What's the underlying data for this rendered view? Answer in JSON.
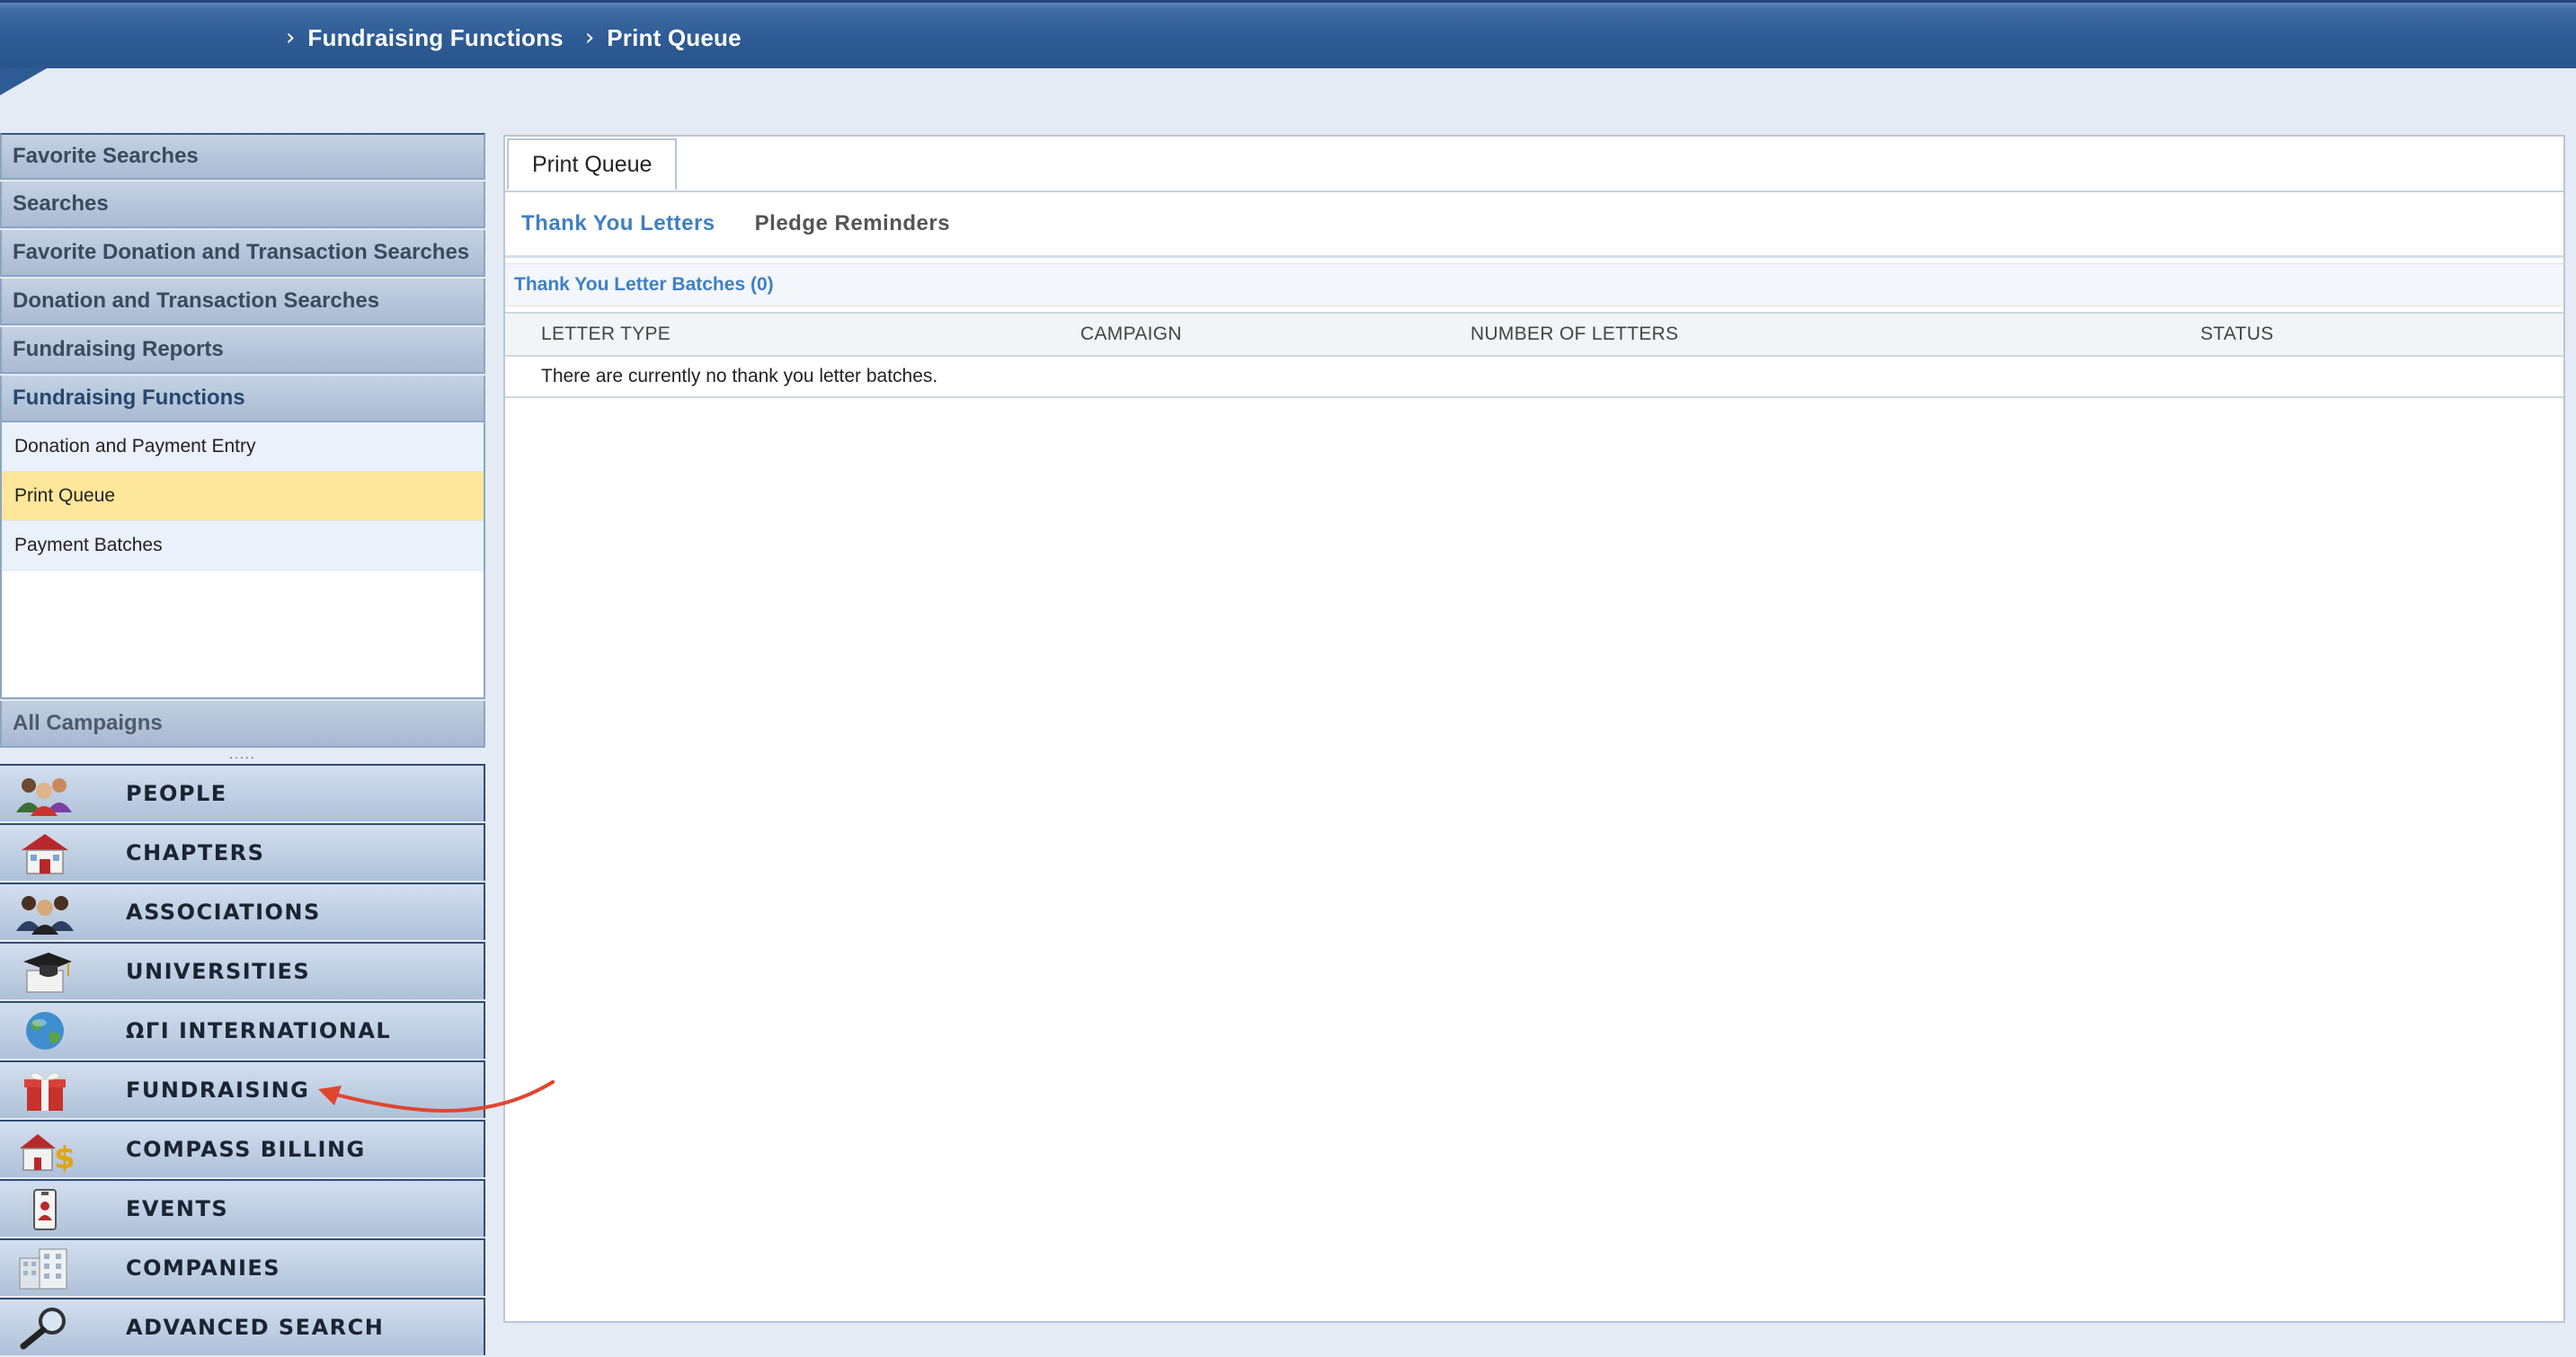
{
  "breadcrumb": {
    "items": [
      "Fundraising Functions",
      "Print Queue"
    ]
  },
  "sidebar": {
    "sections": [
      {
        "label": "Favorite Searches"
      },
      {
        "label": "Searches"
      },
      {
        "label": "Favorite Donation and Transaction Searches"
      },
      {
        "label": "Donation and Transaction Searches"
      },
      {
        "label": "Fundraising Reports"
      },
      {
        "label": "Fundraising Functions"
      }
    ],
    "function_items": [
      {
        "label": "Donation and Payment Entry"
      },
      {
        "label": "Print Queue"
      },
      {
        "label": "Payment Batches"
      }
    ],
    "campaigns_label": "All Campaigns",
    "grip": "....."
  },
  "modules": [
    {
      "label": "PEOPLE",
      "icon": "people-icon"
    },
    {
      "label": "CHAPTERS",
      "icon": "house-icon"
    },
    {
      "label": "ASSOCIATIONS",
      "icon": "associations-icon"
    },
    {
      "label": "UNIVERSITIES",
      "icon": "graduation-cap-icon"
    },
    {
      "label": "ΩΓΙ INTERNATIONAL",
      "icon": "globe-icon"
    },
    {
      "label": "FUNDRAISING",
      "icon": "gift-icon"
    },
    {
      "label": "COMPASS BILLING",
      "icon": "billing-icon"
    },
    {
      "label": "EVENTS",
      "icon": "badge-icon"
    },
    {
      "label": "COMPANIES",
      "icon": "building-icon"
    },
    {
      "label": "ADVANCED SEARCH",
      "icon": "magnifier-icon"
    }
  ],
  "main": {
    "tab": "Print Queue",
    "subtabs": [
      "Thank You Letters",
      "Pledge Reminders"
    ],
    "batch_title": "Thank You Letter Batches (0)",
    "columns": [
      "LETTER TYPE",
      "CAMPAIGN",
      "NUMBER OF LETTERS",
      "STATUS"
    ],
    "empty_message": "There are currently no thank you letter batches."
  },
  "colors": {
    "header": "#2e5b95",
    "accent_link": "#3f7fc4",
    "selected_item": "#fde79a",
    "annotation_arrow": "#e0452f"
  }
}
